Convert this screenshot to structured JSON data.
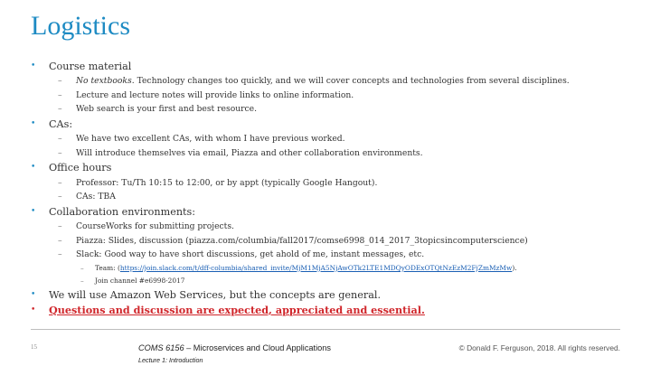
{
  "title": "Logistics",
  "bullets": {
    "course_material": {
      "label": "Course material",
      "items": [
        {
          "italic": "No textbooks",
          "text": ". Technology changes too quickly, and we will cover concepts and technologies from several disciplines."
        },
        {
          "text": "Lecture and lecture notes will provide links to online information."
        },
        {
          "text": "Web search is your first and best resource."
        }
      ]
    },
    "cas": {
      "label": "CAs:",
      "items": [
        {
          "text": "We have two excellent CAs, with whom I have previous worked."
        },
        {
          "text": "Will introduce themselves via email, Piazza and other collaboration environments."
        }
      ]
    },
    "office_hours": {
      "label": "Office hours",
      "items": [
        {
          "text": "Professor: Tu/Th 10:15 to 12:00, or by appt (typically Google Hangout)."
        },
        {
          "text": "CAs: TBA"
        }
      ]
    },
    "collaboration": {
      "label": "Collaboration environments:",
      "items": [
        {
          "text": "CourseWorks for submitting projects."
        },
        {
          "text": "Piazza: Slides, discussion (piazza.com/columbia/fall2017/comse6998_014_2017_3topicsincomputerscience)"
        },
        {
          "text": "Slack: Good way to have short discussions, get ahold of me, instant messages, etc."
        }
      ],
      "sub_items": [
        {
          "prefix": "Team: (",
          "link": "https://join.slack.com/t/dff-columbia/shared_invite/MjM1MjA5NjAwOTk2LTE1MDQyODExOTQtNzEzM2FjZmMzMw",
          "suffix": ")."
        },
        {
          "text": "Join channel #e6998-2017"
        }
      ]
    },
    "aws": {
      "label": "We will use Amazon Web Services, but the concepts are general."
    },
    "questions": {
      "label": "Questions and discussion are expected, appreciated and essential."
    }
  },
  "footer": {
    "page_number": "15",
    "course_code": "COMS 6156",
    "course_title": " – Microservices and Cloud Applications",
    "lecture": "Lecture 1: Introduction",
    "copyright": "© Donald F. Ferguson, 2018. All rights reserved."
  },
  "colors": {
    "accent": "#1e8bc3",
    "emphasis": "#d0262b"
  }
}
